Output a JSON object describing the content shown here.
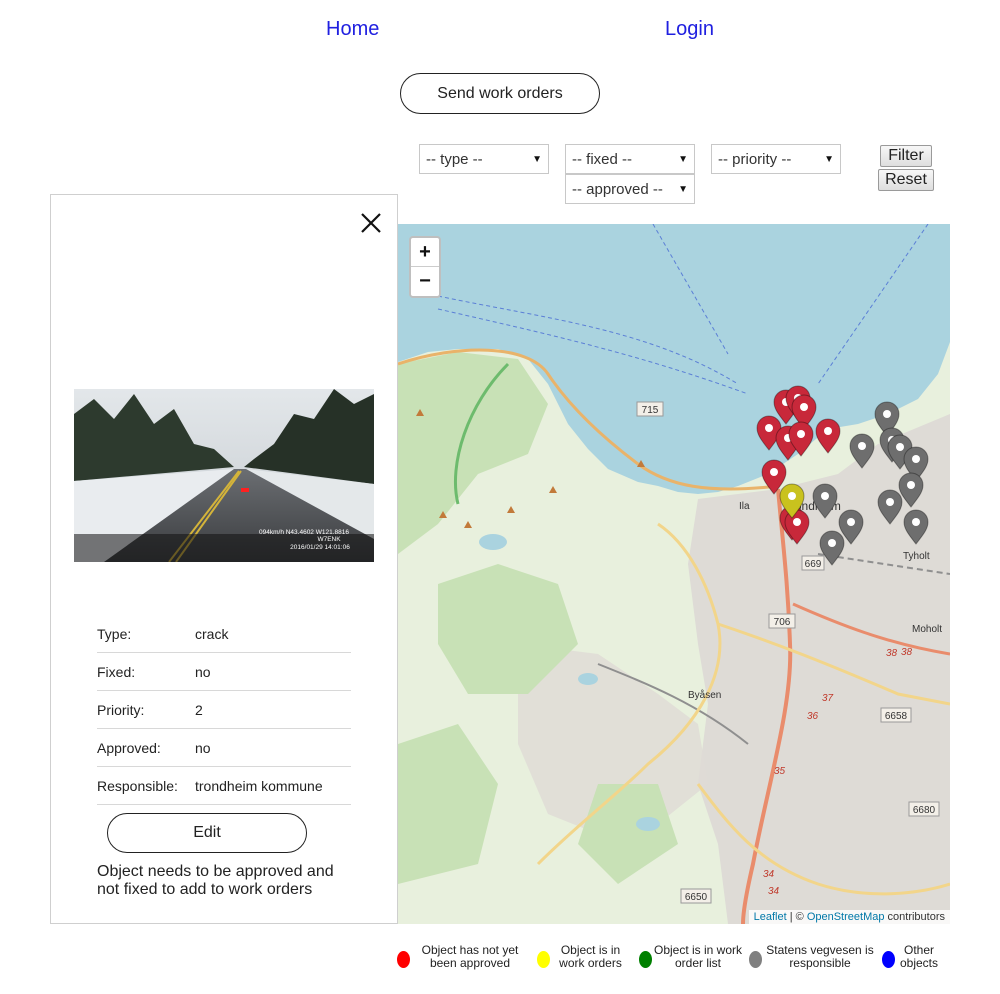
{
  "nav": {
    "home": "Home",
    "login": "Login"
  },
  "send_button": "Send work orders",
  "filters": {
    "type": "-- type --",
    "fixed": "-- fixed --",
    "priority": "-- priority --",
    "approved": "-- approved --",
    "filter_label": "Filter",
    "reset_label": "Reset"
  },
  "photo_overlay": {
    "line1": "094km/h N43.4602 W121.8816",
    "line2": "W7ENK",
    "line3": "2016/01/29 14:01:06"
  },
  "details": {
    "rows": [
      {
        "label": "Type:",
        "value": "crack"
      },
      {
        "label": "Fixed:",
        "value": "no"
      },
      {
        "label": "Priority:",
        "value": "2"
      },
      {
        "label": "Approved:",
        "value": "no"
      },
      {
        "label": "Responsible:",
        "value": "trondheim kommune"
      }
    ],
    "edit_label": "Edit",
    "note": "Object needs to be approved and not fixed to add to work orders"
  },
  "map": {
    "zoom_in": "+",
    "zoom_out": "−",
    "attribution_leaflet": "Leaflet",
    "attribution_sep": " | © ",
    "attribution_osm": "OpenStreetMap",
    "attribution_tail": " contributors",
    "labels": {
      "road715": "715",
      "road706": "706",
      "road669": "669",
      "road6658": "6658",
      "road6680": "6680",
      "road6650": "6650",
      "r38a": "38",
      "r38b": "38",
      "r37": "37",
      "r36": "36",
      "r35": "35",
      "r34a": "34",
      "r34b": "34",
      "ila": "Ila",
      "trondheim": "Trondheim",
      "tyholt": "Tyholt",
      "moholt": "Moholt",
      "byasen": "Byåsen"
    }
  },
  "legend": [
    {
      "line1": "Object has not yet",
      "line2": "been approved",
      "color": "#ff0000"
    },
    {
      "line1": "Object is in",
      "line2": "work orders",
      "color": "#ffff00"
    },
    {
      "line1": "Object is in work",
      "line2": "order list",
      "color": "#008000"
    },
    {
      "line1": "Statens vegvesen is",
      "line2": "responsible",
      "color": "#808080"
    },
    {
      "line1": "Other",
      "line2": "objects",
      "color": "#0000ff"
    }
  ],
  "colors": {
    "marker_red": "#c8283a",
    "marker_gray": "#6e6e6e",
    "marker_yellow": "#c9c21e",
    "link": "#2020e0"
  }
}
